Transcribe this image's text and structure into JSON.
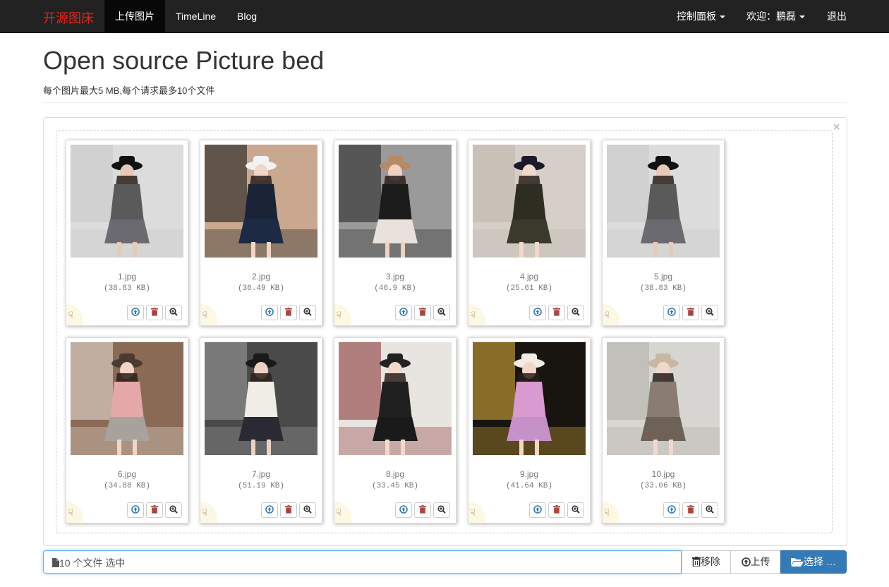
{
  "navbar": {
    "brand": "开源图床",
    "links": [
      {
        "label": "上传图片",
        "active": true
      },
      {
        "label": "TimeLine",
        "active": false
      },
      {
        "label": "Blog",
        "active": false
      }
    ],
    "right": {
      "control_panel": "控制面板",
      "welcome": "欢迎：鹏磊",
      "logout": "退出"
    }
  },
  "header": {
    "title": "Open source Picture bed",
    "subtitle": "每个图片最大5 MB,每个请求最多10个文件"
  },
  "panel": {
    "close": "×",
    "files": [
      {
        "name": "1.jpg",
        "size": "(38.83 KB)"
      },
      {
        "name": "2.jpg",
        "size": "(36.49 KB)"
      },
      {
        "name": "3.jpg",
        "size": "(46.9 KB)"
      },
      {
        "name": "4.jpg",
        "size": "(25.61 KB)"
      },
      {
        "name": "5.jpg",
        "size": "(38.83 KB)"
      },
      {
        "name": "6.jpg",
        "size": "(34.88 KB)"
      },
      {
        "name": "7.jpg",
        "size": "(51.19 KB)"
      },
      {
        "name": "8.jpg",
        "size": "(33.45 KB)"
      },
      {
        "name": "9.jpg",
        "size": "(41.64 KB)"
      },
      {
        "name": "10.jpg",
        "size": "(33.06 KB)"
      }
    ]
  },
  "file_input": {
    "caption": "10 个文件 选中",
    "remove_label": "移除",
    "upload_label": "上传",
    "browse_label": "选择 …"
  },
  "icons": {
    "drag": "hand-point-icon",
    "upload": "circle-arrow-up-icon",
    "delete": "trash-icon",
    "zoom": "zoom-in-icon",
    "file": "file-icon",
    "folder": "folder-open-icon"
  },
  "colors": {
    "brand": "#e8211b",
    "navbar_bg": "#222222",
    "primary": "#337ab7",
    "danger": "#a94442",
    "drag_bg": "#fcf8e3"
  }
}
